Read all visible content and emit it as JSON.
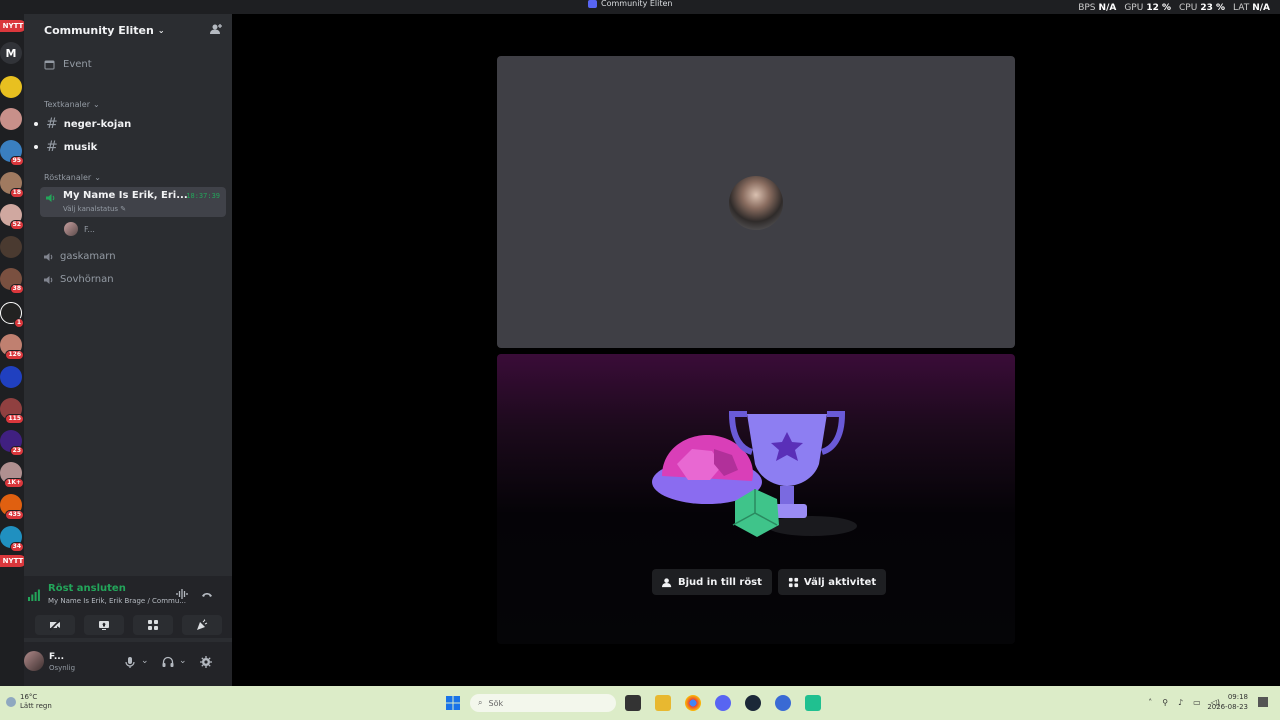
{
  "window": {
    "title": "Community Eliten"
  },
  "overlay": {
    "bps_label": "BPS",
    "bps_value": "N/A",
    "gpu_label": "GPU",
    "gpu_value": "12 %",
    "cpu_label": "CPU",
    "cpu_value": "23 %",
    "lat_label": "LAT",
    "lat_value": "N/A"
  },
  "rail": {
    "top_badge": "NYTT",
    "letter_server": "M",
    "badges": [
      "95",
      "18",
      "52",
      "38",
      "1",
      "126",
      "115",
      "23",
      "1K+",
      "435",
      "34"
    ],
    "bottom_badge": "NYTT"
  },
  "sidebar": {
    "server_name": "Community Eliten",
    "event_label": "Event",
    "text_category": "Textkanaler",
    "text_channels": [
      {
        "name": "neger-kojan"
      },
      {
        "name": "musik"
      }
    ],
    "voice_category": "Röstkanaler",
    "active_voice": {
      "name": "My Name Is Erik, Eri...",
      "time": "18:37:39",
      "status": "Välj kanalstatus"
    },
    "voice_member": "F...",
    "voice_channels": [
      {
        "name": "gaskamarn"
      },
      {
        "name": "Sovhörnan"
      }
    ]
  },
  "rtc": {
    "status": "Röst ansluten",
    "subtitle": "My Name Is Erik, Erik Brage / Commu..."
  },
  "user": {
    "name": "F...",
    "status": "Osynlig"
  },
  "main": {
    "invite_button": "Bjud in till röst",
    "activity_button": "Välj aktivitet"
  },
  "taskbar": {
    "temp": "16°C",
    "weather": "Lätt regn",
    "search_placeholder": "Sök",
    "time": "09:18",
    "date": "2026-08-23"
  },
  "colors": {
    "accent_green": "#23a55a",
    "badge_red": "#da373c",
    "sidebar_bg": "#2b2d31",
    "rail_bg": "#1e1f22"
  }
}
